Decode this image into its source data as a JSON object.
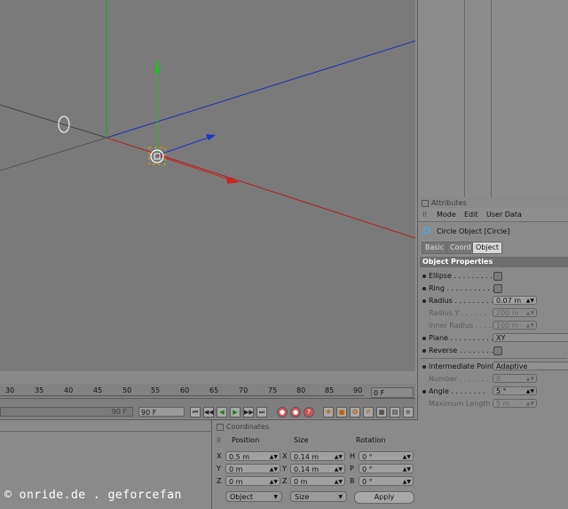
{
  "timeline": {
    "ticks": [
      "30",
      "35",
      "40",
      "45",
      "50",
      "55",
      "60",
      "65",
      "70",
      "75",
      "80",
      "85",
      "90"
    ],
    "current_frame": "0 F",
    "end_field": "90 F",
    "end_field_2": "90 F"
  },
  "attributes": {
    "title": "Attributes",
    "menu": [
      "Mode",
      "Edit",
      "User Data"
    ],
    "object_name": "Circle Object [Circle]",
    "tabs": [
      "Basic",
      "Coord",
      "Object"
    ],
    "section": "Object Properties",
    "properties": {
      "ellipse": "Ellipse . . . . . . . . . .",
      "ring": "Ring . . . . . . . . . . .",
      "radius": "Radius . . . . . . . . .",
      "radius_value": "0.07 m",
      "radius_y": "Radius Y . . . . . .",
      "radius_y_value": "200 m",
      "inner_radius": "Inner Radius . . . .",
      "inner_radius_value": "100 m",
      "plane": "Plane . . . . . . . . . .",
      "plane_value": "XY",
      "reverse": "Reverse . . . . . . . .",
      "intermediate_points": "Intermediate Points",
      "intermediate_points_value": "Adaptive",
      "number": "Number . . . . . . .",
      "number_value": "8",
      "angle": "Angle . . . . . . . .",
      "angle_value": "5 °",
      "max_length": "Maximum Length",
      "max_length_value": "5 m"
    }
  },
  "coordinates": {
    "title": "Coordinates",
    "headers": [
      "Position",
      "Size",
      "Rotation"
    ],
    "rows": [
      {
        "p_axis": "X",
        "p_val": "0.5 m",
        "s_axis": "X",
        "s_val": "0.14 m",
        "r_axis": "H",
        "r_val": "0 °"
      },
      {
        "p_axis": "Y",
        "p_val": "0 m",
        "s_axis": "Y",
        "s_val": "0.14 m",
        "r_axis": "P",
        "r_val": "0 °"
      },
      {
        "p_axis": "Z",
        "p_val": "0 m",
        "s_axis": "Z",
        "s_val": "0 m",
        "r_axis": "B",
        "r_val": "0 °"
      }
    ],
    "mode_dropdown": "Object",
    "size_dropdown": "Size",
    "apply": "Apply"
  },
  "watermark": "© onride.de . geforcefan",
  "colors": {
    "x_axis": "#b02020",
    "y_axis": "#20a020",
    "z_axis": "#2030b0"
  }
}
